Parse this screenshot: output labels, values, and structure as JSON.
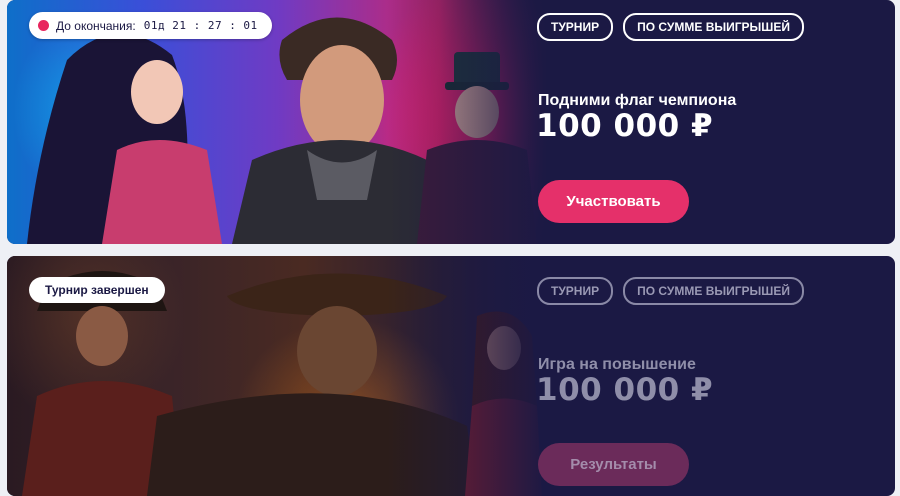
{
  "tournaments": [
    {
      "timer_label": "До окончания:",
      "timer_value": "01д  21 : 27 : 01",
      "tags": [
        "ТУРНИР",
        "ПО СУММЕ ВЫИГРЫШЕЙ"
      ],
      "subtitle": "Подними флаг чемпиона",
      "prize": "100 000 ₽",
      "button_label": "Участвовать",
      "accent": "#e5306a"
    },
    {
      "status_label": "Турнир завершен",
      "tags": [
        "ТУРНИР",
        "ПО СУММЕ ВЫИГРЫШЕЙ"
      ],
      "subtitle": "Игра на повышение",
      "prize": "100 000 ₽",
      "button_label": "Результаты",
      "accent": "#6b2b5a"
    }
  ]
}
